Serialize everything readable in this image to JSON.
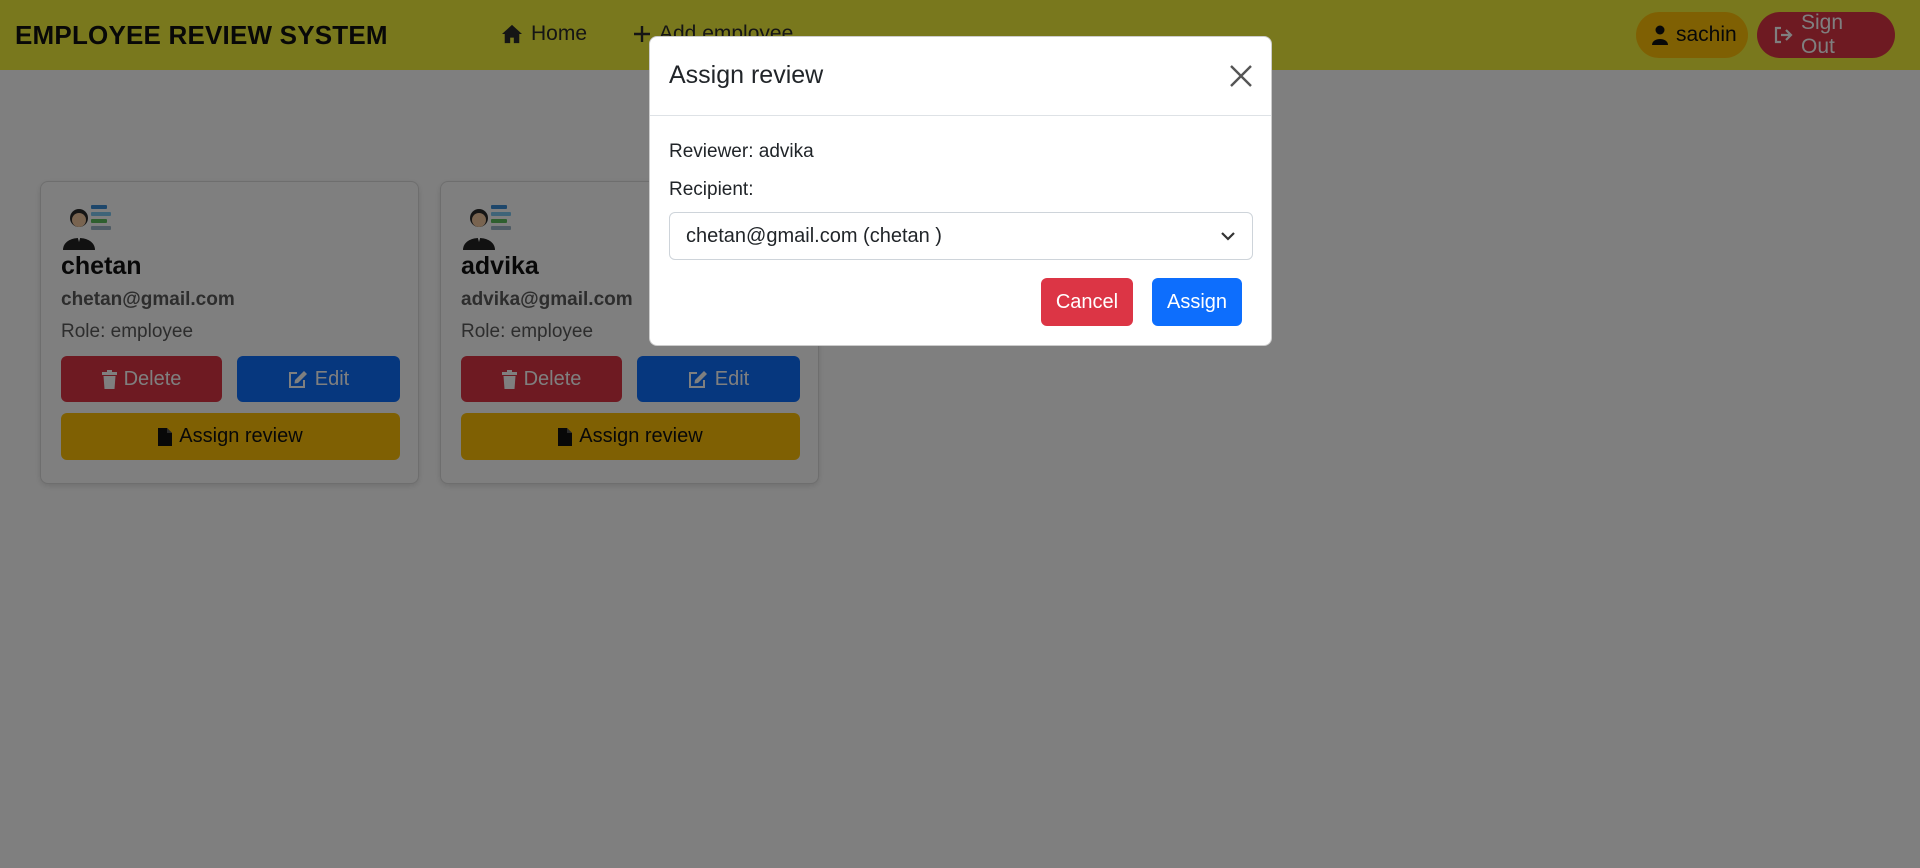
{
  "navbar": {
    "brand": "EMPLOYEE REVIEW SYSTEM",
    "home_label": "Home",
    "add_label": "Add employee",
    "user_label": "sachin",
    "signout_label": "Sign Out",
    "bg_color": "#f2f03b"
  },
  "employees": [
    {
      "name": "chetan",
      "email": "chetan@gmail.com",
      "role": "Role: employee",
      "delete_label": "Delete",
      "edit_label": "Edit",
      "assign_label": "Assign review"
    },
    {
      "name": "advika",
      "email": "advika@gmail.com",
      "role": "Role: employee",
      "delete_label": "Delete",
      "edit_label": "Edit",
      "assign_label": "Assign review"
    }
  ],
  "modal": {
    "title": "Assign review",
    "reviewer": "Reviewer: advika",
    "recipient_label": "Recipient:",
    "recipient_value": "chetan@gmail.com (chetan )",
    "cancel_label": "Cancel",
    "assign_label": "Assign"
  },
  "colors": {
    "danger": "#dc3545",
    "primary": "#0d6efd",
    "warning": "#ffc107"
  }
}
